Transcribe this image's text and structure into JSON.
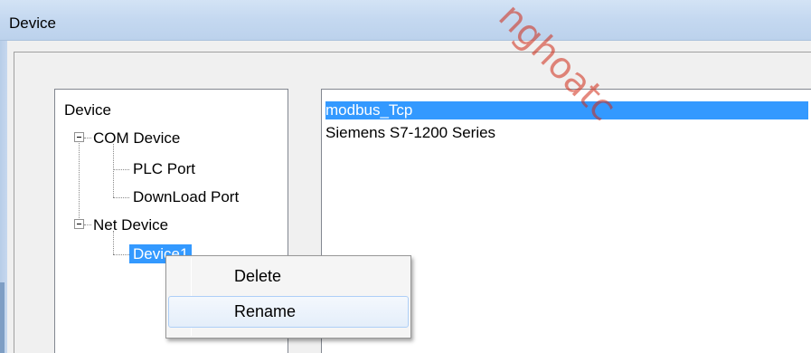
{
  "window": {
    "title": "Device"
  },
  "tree": {
    "root": "Device",
    "com_device": "COM Device",
    "plc_port": "PLC Port",
    "download_port": "DownLoad Port",
    "net_device": "Net Device",
    "device1": "Device1"
  },
  "device_list": {
    "items": [
      "modbus_Tcp",
      "Siemens S7-1200 Series"
    ],
    "selected_index": 0
  },
  "context_menu": {
    "items": [
      "Delete",
      "Rename"
    ],
    "hovered": "Rename"
  },
  "colors": {
    "selection": "#3399ff",
    "titlebar": "#c4d8f0",
    "watermark": "#d02814"
  }
}
